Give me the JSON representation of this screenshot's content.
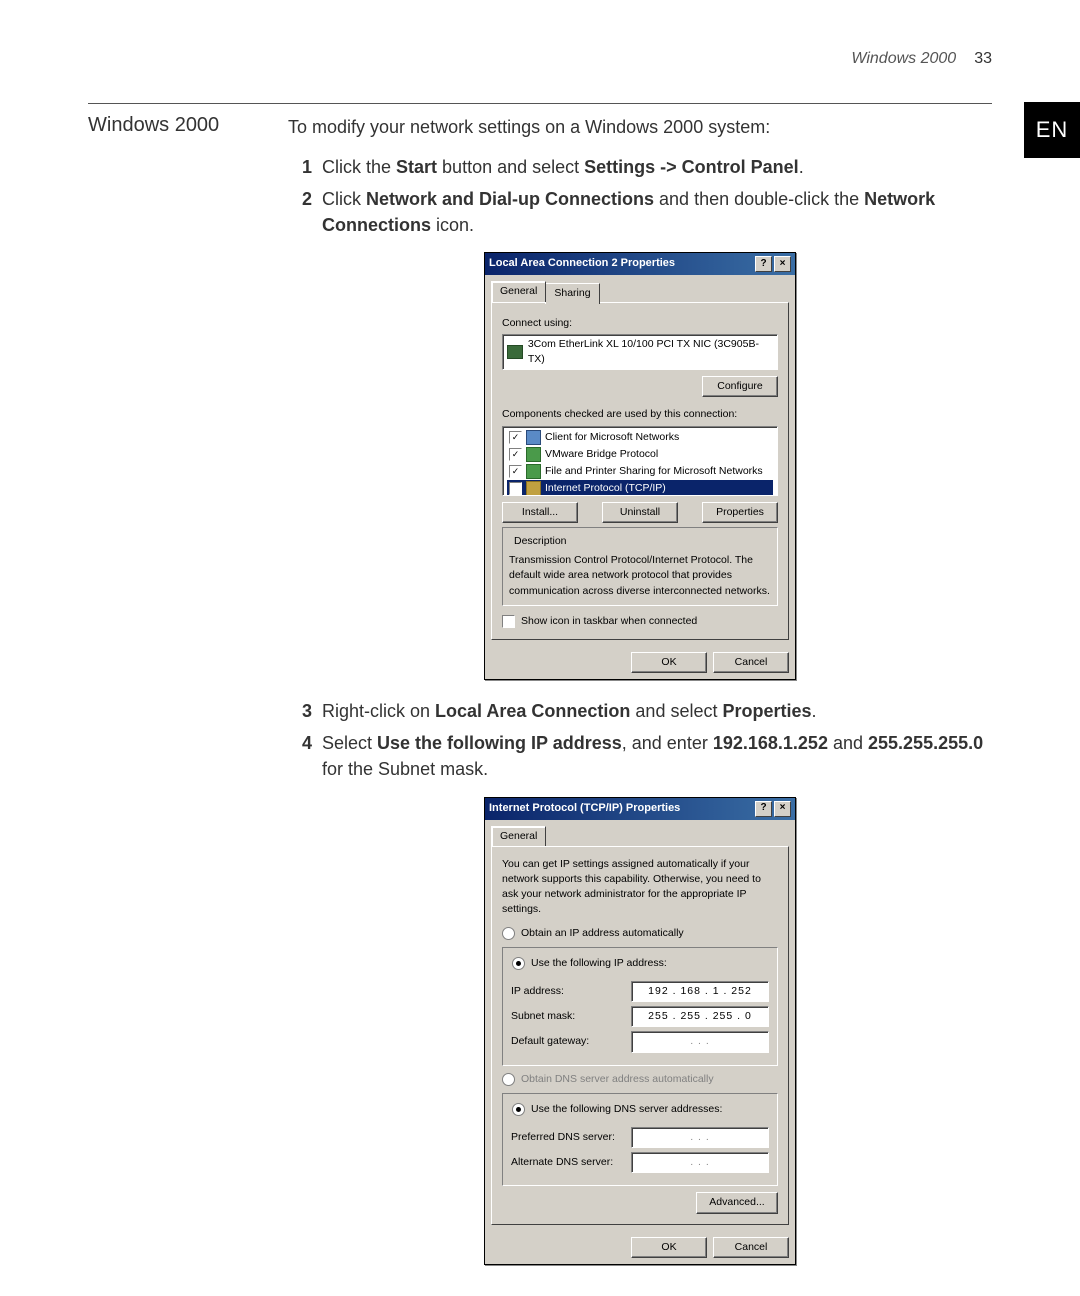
{
  "header": {
    "running": "Windows 2000",
    "page": "33"
  },
  "sideTag": "EN",
  "sectionHeading": "Windows 2000",
  "intro": "To modify your network settings on a Windows 2000 system:",
  "steps": {
    "s1": {
      "n": "1",
      "a": "Click the ",
      "b": "Start",
      "c": " button and select ",
      "d": "Settings -> Control Panel",
      "e": "."
    },
    "s2": {
      "n": "2",
      "a": "Click ",
      "b": "Network and Dial-up Connections",
      "c": " and then double-click the ",
      "d": "Network Connections",
      "e": " icon."
    },
    "s3": {
      "n": "3",
      "a": "Right-click on ",
      "b": "Local Area Connection",
      "c": " and select ",
      "d": "Properties",
      "e": "."
    },
    "s4": {
      "n": "4",
      "a": "Select ",
      "b": "Use the following IP address",
      "c": ", and enter ",
      "d": "192.168.1.252",
      "e": " and ",
      "f": "255.255.255.0",
      "g": " for the Subnet mask."
    }
  },
  "dlg1": {
    "title": "Local Area Connection 2 Properties",
    "tabGeneral": "General",
    "tabSharing": "Sharing",
    "connectUsing": "Connect using:",
    "nic": "3Com EtherLink XL 10/100 PCI TX NIC (3C905B-TX)",
    "configureBtn": "Configure",
    "componentsLbl": "Components checked are used by this connection:",
    "comp1": "Client for Microsoft Networks",
    "comp2": "VMware Bridge Protocol",
    "comp3": "File and Printer Sharing for Microsoft Networks",
    "comp4": "Internet Protocol (TCP/IP)",
    "installBtn": "Install...",
    "uninstallBtn": "Uninstall",
    "propertiesBtn": "Properties",
    "descLbl": "Description",
    "descText": "Transmission Control Protocol/Internet Protocol. The default wide area network protocol that provides communication across diverse interconnected networks.",
    "showIcon": "Show icon in taskbar when connected",
    "ok": "OK",
    "cancel": "Cancel"
  },
  "dlg2": {
    "title": "Internet Protocol (TCP/IP) Properties",
    "tabGeneral": "General",
    "blurb": "You can get IP settings assigned automatically if your network supports this capability. Otherwise, you need to ask your network administrator for the appropriate IP settings.",
    "rAuto": "Obtain an IP address automatically",
    "rManual": "Use the following IP address:",
    "ipLbl": "IP address:",
    "ipVal": "192 . 168 .  1  . 252",
    "maskLbl": "Subnet mask:",
    "maskVal": "255 . 255 . 255 .  0 ",
    "gwLbl": "Default gateway:",
    "gwVal": " .       .       . ",
    "rDnsAuto": "Obtain DNS server address automatically",
    "rDnsManual": "Use the following DNS server addresses:",
    "dns1Lbl": "Preferred DNS server:",
    "dns1Val": " .       .       . ",
    "dns2Lbl": "Alternate DNS server:",
    "dns2Val": " .       .       . ",
    "advBtn": "Advanced...",
    "ok": "OK",
    "cancel": "Cancel"
  }
}
